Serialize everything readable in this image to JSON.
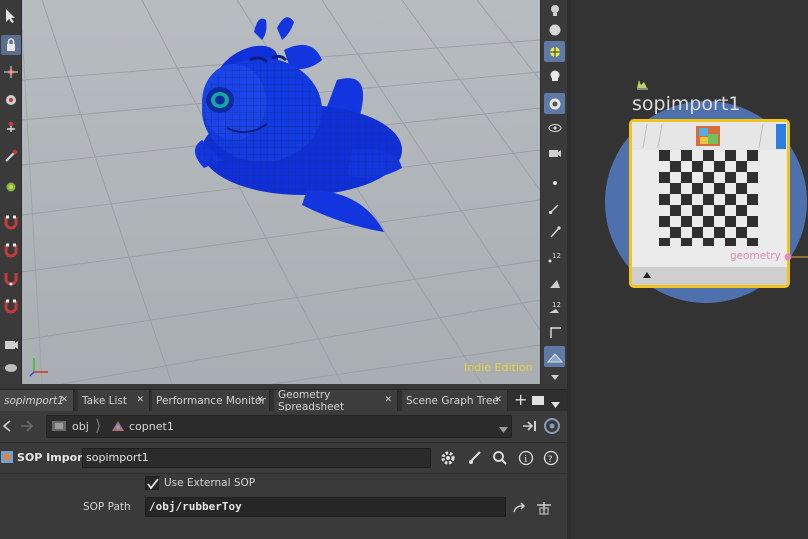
{
  "viewport": {
    "watermark": "Indie Edition"
  },
  "tabs": [
    {
      "label": "sopimport1",
      "current": true
    },
    {
      "label": "Take List"
    },
    {
      "label": "Performance Monitor"
    },
    {
      "label": "Geometry Spreadsheet"
    },
    {
      "label": "Scene Graph Tree"
    }
  ],
  "path": {
    "root": "obj",
    "node": "copnet1"
  },
  "params": {
    "node_type": "SOP Import",
    "node_name": "sopimport1",
    "use_external_label": "Use External SOP",
    "use_external_checked": true,
    "sop_path_label": "SOP Path",
    "sop_path_value": "/obj/rubberToy"
  },
  "network": {
    "node_name": "sopimport1",
    "output_label": "geometry"
  },
  "colors": {
    "accent": "#5f7aa6",
    "watermark": "#e8d236",
    "node_selected": "#f0c419",
    "output": "#e889b8"
  },
  "icons": [
    "select-icon",
    "lock-icon",
    "magnet-icon",
    "gear-icon",
    "help-icon",
    "search-icon",
    "info-icon",
    "pin-icon"
  ]
}
